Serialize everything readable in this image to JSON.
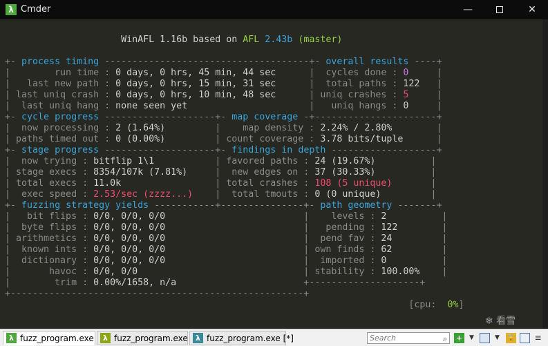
{
  "window": {
    "title": "Cmder",
    "app_icon_glyph": "λ",
    "minimize_glyph": "—",
    "close_glyph": "✕"
  },
  "terminal": {
    "lines": [
      [
        {
          "t": "                     WinAFL 1.16b based on ",
          "c": "light"
        },
        {
          "t": "AFL ",
          "c": "green"
        },
        {
          "t": "2.43b ",
          "c": "blue"
        },
        {
          "t": "(master)",
          "c": "green"
        }
      ],
      [],
      [
        {
          "t": "+- ",
          "c": "gray"
        },
        {
          "t": "process timing",
          "c": "blue"
        },
        {
          "t": " -------------------------------------+- ",
          "c": "gray"
        },
        {
          "t": "overall results",
          "c": "blue"
        },
        {
          "t": " ----+",
          "c": "gray"
        }
      ],
      [
        {
          "t": "|        run time : ",
          "c": "gray"
        },
        {
          "t": "0 days, 0 hrs, 45 min, 44 sec",
          "c": "light"
        },
        {
          "t": "      |  cycles done : ",
          "c": "gray"
        },
        {
          "t": "0",
          "c": "purple"
        },
        {
          "t": "     |",
          "c": "gray"
        }
      ],
      [
        {
          "t": "|   last new path : ",
          "c": "gray"
        },
        {
          "t": "0 days, 0 hrs, 15 min, 31 sec",
          "c": "light"
        },
        {
          "t": "      |  total paths : ",
          "c": "gray"
        },
        {
          "t": "122",
          "c": "light"
        },
        {
          "t": "   |",
          "c": "gray"
        }
      ],
      [
        {
          "t": "| last uniq crash : ",
          "c": "gray"
        },
        {
          "t": "0 days, 0 hrs, 10 min, 48 sec",
          "c": "light"
        },
        {
          "t": "      | uniq crashes : ",
          "c": "gray"
        },
        {
          "t": "5",
          "c": "red"
        },
        {
          "t": "     |",
          "c": "gray"
        }
      ],
      [
        {
          "t": "|  last uniq hang : ",
          "c": "gray"
        },
        {
          "t": "none seen yet",
          "c": "light"
        },
        {
          "t": "                      |   uniq hangs : ",
          "c": "gray"
        },
        {
          "t": "0",
          "c": "light"
        },
        {
          "t": "     |",
          "c": "gray"
        }
      ],
      [
        {
          "t": "+- ",
          "c": "gray"
        },
        {
          "t": "cycle progress",
          "c": "blue"
        },
        {
          "t": " --------------------+- ",
          "c": "gray"
        },
        {
          "t": "map coverage",
          "c": "blue"
        },
        {
          "t": " -+----------------------+",
          "c": "gray"
        }
      ],
      [
        {
          "t": "|  now processing : ",
          "c": "gray"
        },
        {
          "t": "2 (1.64%)",
          "c": "light"
        },
        {
          "t": "         |    map density : ",
          "c": "gray"
        },
        {
          "t": "2.24% / 2.80%",
          "c": "light"
        },
        {
          "t": "        |",
          "c": "gray"
        }
      ],
      [
        {
          "t": "| paths timed out : ",
          "c": "gray"
        },
        {
          "t": "0 (0.00%)",
          "c": "light"
        },
        {
          "t": "         | count coverage : ",
          "c": "gray"
        },
        {
          "t": "3.78 bits/tuple",
          "c": "light"
        },
        {
          "t": "      |",
          "c": "gray"
        }
      ],
      [
        {
          "t": "+- ",
          "c": "gray"
        },
        {
          "t": "stage progress",
          "c": "blue"
        },
        {
          "t": " --------------------+- ",
          "c": "gray"
        },
        {
          "t": "findings in depth",
          "c": "blue"
        },
        {
          "t": " -------------------+",
          "c": "gray"
        }
      ],
      [
        {
          "t": "|  now trying : ",
          "c": "gray"
        },
        {
          "t": "bitflip 1\\1",
          "c": "light"
        },
        {
          "t": "           | favored paths : ",
          "c": "gray"
        },
        {
          "t": "24 (19.67%)",
          "c": "light"
        },
        {
          "t": "          |",
          "c": "gray"
        }
      ],
      [
        {
          "t": "| stage execs : ",
          "c": "gray"
        },
        {
          "t": "8354/107k (7.81%)",
          "c": "light"
        },
        {
          "t": "     |  new edges on : ",
          "c": "gray"
        },
        {
          "t": "37 (30.33%)",
          "c": "light"
        },
        {
          "t": "          |",
          "c": "gray"
        }
      ],
      [
        {
          "t": "| total execs : ",
          "c": "gray"
        },
        {
          "t": "11.0k",
          "c": "light"
        },
        {
          "t": "                 | total crashes : ",
          "c": "gray"
        },
        {
          "t": "108 (5 unique)",
          "c": "red"
        },
        {
          "t": "       |",
          "c": "gray"
        }
      ],
      [
        {
          "t": "|  exec speed : ",
          "c": "gray"
        },
        {
          "t": "2.53/sec (zzzz...)",
          "c": "red"
        },
        {
          "t": "    |  total tmouts : ",
          "c": "gray"
        },
        {
          "t": "0 (0 unique)",
          "c": "light"
        },
        {
          "t": "         |",
          "c": "gray"
        }
      ],
      [
        {
          "t": "+- ",
          "c": "gray"
        },
        {
          "t": "fuzzing strategy yields",
          "c": "blue"
        },
        {
          "t": " -----------+---------------+- ",
          "c": "gray"
        },
        {
          "t": "path geometry",
          "c": "blue"
        },
        {
          "t": " -------+",
          "c": "gray"
        }
      ],
      [
        {
          "t": "|   bit flips : ",
          "c": "gray"
        },
        {
          "t": "0/0, 0/0, 0/0",
          "c": "light"
        },
        {
          "t": "                         |    levels : ",
          "c": "gray"
        },
        {
          "t": "2",
          "c": "light"
        },
        {
          "t": "          |",
          "c": "gray"
        }
      ],
      [
        {
          "t": "|  byte flips : ",
          "c": "gray"
        },
        {
          "t": "0/0, 0/0, 0/0",
          "c": "light"
        },
        {
          "t": "                         |   pending : ",
          "c": "gray"
        },
        {
          "t": "122",
          "c": "light"
        },
        {
          "t": "        |",
          "c": "gray"
        }
      ],
      [
        {
          "t": "| arithmetics : ",
          "c": "gray"
        },
        {
          "t": "0/0, 0/0, 0/0",
          "c": "light"
        },
        {
          "t": "                         |  pend fav : ",
          "c": "gray"
        },
        {
          "t": "24",
          "c": "light"
        },
        {
          "t": "         |",
          "c": "gray"
        }
      ],
      [
        {
          "t": "|  known ints : ",
          "c": "gray"
        },
        {
          "t": "0/0, 0/0, 0/0",
          "c": "light"
        },
        {
          "t": "                         | own finds : ",
          "c": "gray"
        },
        {
          "t": "62",
          "c": "light"
        },
        {
          "t": "         |",
          "c": "gray"
        }
      ],
      [
        {
          "t": "|  dictionary : ",
          "c": "gray"
        },
        {
          "t": "0/0, 0/0, 0/0",
          "c": "light"
        },
        {
          "t": "                         |  imported : ",
          "c": "gray"
        },
        {
          "t": "0",
          "c": "light"
        },
        {
          "t": "          |",
          "c": "gray"
        }
      ],
      [
        {
          "t": "|       havoc : ",
          "c": "gray"
        },
        {
          "t": "0/0, 0/0",
          "c": "light"
        },
        {
          "t": "                              | stability : ",
          "c": "gray"
        },
        {
          "t": "100.00%",
          "c": "light"
        },
        {
          "t": "    |",
          "c": "gray"
        }
      ],
      [
        {
          "t": "|        trim : ",
          "c": "gray"
        },
        {
          "t": "0.00%/1658, n/a",
          "c": "light"
        },
        {
          "t": "                       +--------------------+",
          "c": "gray"
        }
      ],
      [
        {
          "t": "+-----------------------------------------------------+",
          "c": "gray"
        }
      ],
      [
        {
          "t": "                                                                         [cpu:  ",
          "c": "gray"
        },
        {
          "t": "0%",
          "c": "cpu"
        },
        {
          "t": "]",
          "c": "gray"
        }
      ]
    ]
  },
  "tabs": [
    {
      "label": "fuzz_program.exe",
      "icon": "λ",
      "active": true
    },
    {
      "label": "fuzz_program.exe",
      "icon": "λ",
      "active": false
    },
    {
      "label": "fuzz_program.exe [*]",
      "icon": "λ",
      "active": false
    }
  ],
  "statusbar": {
    "search_placeholder": "Search",
    "search_glyph": "⌕",
    "plus_glyph": "+",
    "dropdown_glyph": "▼",
    "lock_glyph": "🔒",
    "menu_glyph": "≡"
  },
  "watermark": "❄ 看雪"
}
